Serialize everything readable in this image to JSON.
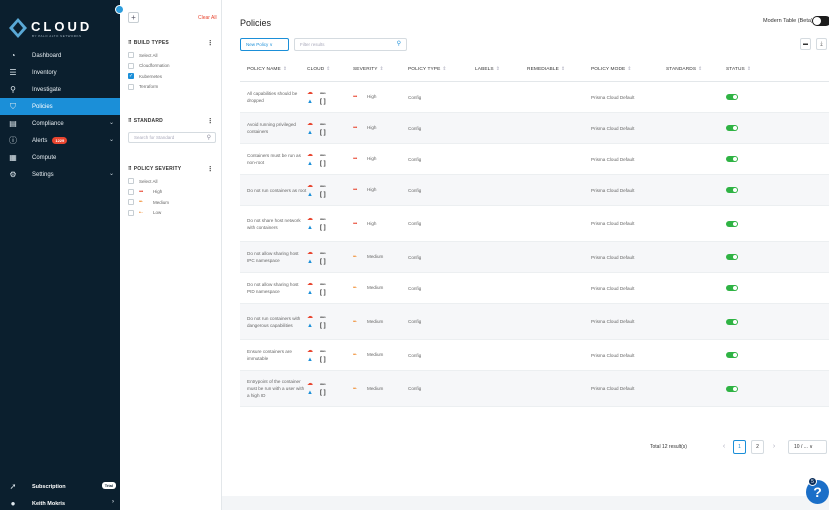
{
  "logo": {
    "text": "CLOUD",
    "sub": "BY PALO ALTO NETWORKS"
  },
  "sidebar": {
    "items": [
      {
        "label": "Dashboard",
        "icon": "gauge-icon",
        "glyph": "◔"
      },
      {
        "label": "Inventory",
        "icon": "list-icon",
        "glyph": "☰"
      },
      {
        "label": "Investigate",
        "icon": "search-icon",
        "glyph": "⚲"
      },
      {
        "label": "Policies",
        "icon": "shield-icon",
        "glyph": "⛉",
        "active": true
      },
      {
        "label": "Compliance",
        "icon": "clipboard-icon",
        "glyph": "▤",
        "chevron": true
      },
      {
        "label": "Alerts",
        "icon": "alert-icon",
        "glyph": "ⓘ",
        "badge": "1229",
        "chevron": true
      },
      {
        "label": "Compute",
        "icon": "compute-icon",
        "glyph": "▦"
      },
      {
        "label": "Settings",
        "icon": "gear-icon",
        "glyph": "⚙",
        "chevron": true
      }
    ],
    "bottom": [
      {
        "label": "Subscription",
        "icon": "rocket-icon",
        "glyph": "➚",
        "badge": "Trial"
      },
      {
        "label": "Keith Mokris",
        "icon": "user-icon",
        "glyph": "●",
        "chevron": "›"
      }
    ]
  },
  "filters": {
    "clear_all": "Clear All",
    "build_types": {
      "title": "BUILD TYPES",
      "options": [
        {
          "label": "Select All",
          "checked": false
        },
        {
          "label": "Cloudformation",
          "checked": false
        },
        {
          "label": "Kubernetes",
          "checked": true
        },
        {
          "label": "Terraform",
          "checked": false
        }
      ]
    },
    "standard": {
      "title": "STANDARD",
      "placeholder": "Search for Standard"
    },
    "severity": {
      "title": "POLICY SEVERITY",
      "options": [
        {
          "label": "Select All",
          "dots": ""
        },
        {
          "label": "High",
          "dots": "•••"
        },
        {
          "label": "Medium",
          "dots": "••·"
        },
        {
          "label": "Low",
          "dots": "•··"
        }
      ]
    }
  },
  "main": {
    "title": "Policies",
    "modern_table": "Modern Table (Beta)",
    "new_policy": "New Policy ∨",
    "filter_placeholder": "Filter results",
    "columns": [
      "POLICY NAME",
      "CLOUD",
      "SEVERITY",
      "POLICY TYPE",
      "LABELS",
      "REMEDIABLE",
      "POLICY MODE",
      "STANDARDS",
      "STATUS"
    ],
    "rows": [
      {
        "name": "All capabilities should be dropped",
        "severity": "High",
        "type": "Config",
        "mode": "Prisma Cloud Default",
        "status": "on"
      },
      {
        "name": "Avoid running privileged containers",
        "severity": "High",
        "type": "Config",
        "mode": "Prisma Cloud Default",
        "status": "on"
      },
      {
        "name": "Containers must be run as non-root",
        "severity": "High",
        "type": "Config",
        "mode": "Prisma Cloud Default",
        "status": "on"
      },
      {
        "name": "Do not run containers as root",
        "severity": "High",
        "type": "Config",
        "mode": "Prisma Cloud Default",
        "status": "on"
      },
      {
        "name": "Do not share host network with containers",
        "severity": "High",
        "type": "Config",
        "mode": "Prisma Cloud Default",
        "status": "on"
      },
      {
        "name": "Do not allow sharing host IPC namespace",
        "severity": "Medium",
        "type": "Config",
        "mode": "Prisma Cloud Default",
        "status": "on"
      },
      {
        "name": "Do not allow sharing host PID namespace",
        "severity": "Medium",
        "type": "Config",
        "mode": "Prisma Cloud Default",
        "status": "on"
      },
      {
        "name": "Do not run containers with dangerous capabilities",
        "severity": "Medium",
        "type": "Config",
        "mode": "Prisma Cloud Default",
        "status": "on"
      },
      {
        "name": "Ensure containers are immutable",
        "severity": "Medium",
        "type": "Config",
        "mode": "Prisma Cloud Default",
        "status": "on"
      },
      {
        "name": "Entrypoint of the container must be run with a user with a high ID",
        "severity": "Medium",
        "type": "Config",
        "mode": "Prisma Cloud Default",
        "status": "on"
      }
    ],
    "cloud_aws": "aws",
    "pagination": {
      "total": "Total 12 result(s)",
      "pages": [
        "1",
        "2"
      ],
      "current": "1",
      "page_size": "10 / ... ∨"
    }
  },
  "help": {
    "badge": "5",
    "label": "?"
  },
  "colors": {
    "sidebar": "#0b1f2e",
    "accent": "#1b8fd8",
    "high": "#e8452f",
    "medium": "#f08a2c",
    "enabled": "#2fb344"
  }
}
